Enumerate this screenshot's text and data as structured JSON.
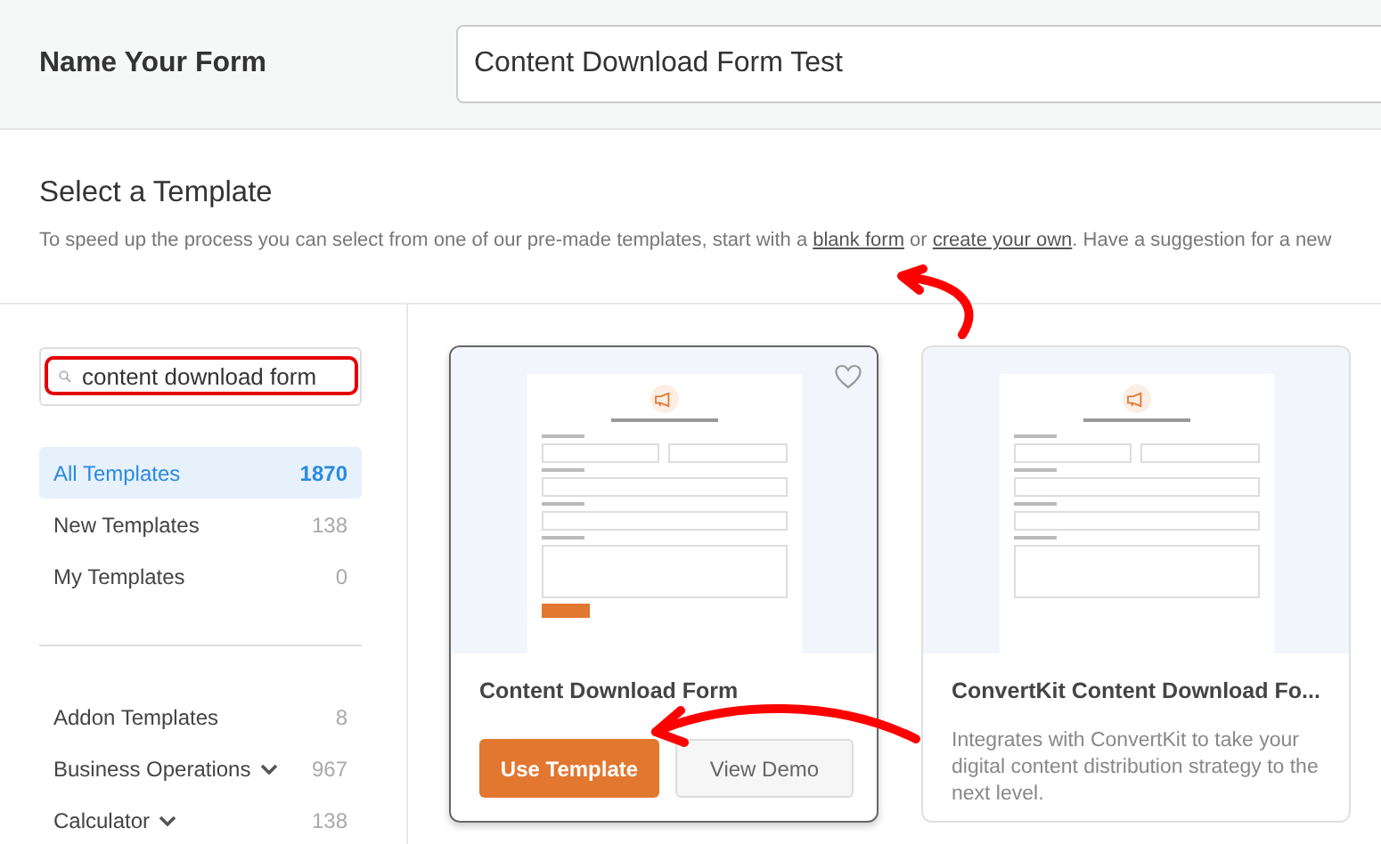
{
  "header": {
    "label": "Name Your Form",
    "form_name": "Content Download Form Test"
  },
  "intro": {
    "title": "Select a Template",
    "text_before": "To speed up the process you can select from one of our pre-made templates, start with a",
    "link_blank": "blank form",
    "text_mid": "or",
    "link_create": "create your own",
    "text_after": ". Have a suggestion for a new"
  },
  "search": {
    "value": "content download form"
  },
  "categories": [
    {
      "label": "All Templates",
      "count": "1870",
      "selected": true,
      "expandable": false
    },
    {
      "label": "New Templates",
      "count": "138",
      "selected": false,
      "expandable": false
    },
    {
      "label": "My Templates",
      "count": "0",
      "selected": false,
      "expandable": false
    }
  ],
  "groups": [
    {
      "label": "Addon Templates",
      "count": "8",
      "selected": false,
      "expandable": false
    },
    {
      "label": "Business Operations",
      "count": "967",
      "selected": false,
      "expandable": true
    },
    {
      "label": "Calculator",
      "count": "138",
      "selected": false,
      "expandable": true
    }
  ],
  "templates": [
    {
      "title": "Content Download Form",
      "hovered": true,
      "favorite_icon": true,
      "buttons": [
        "Use Template",
        "View Demo"
      ]
    },
    {
      "title": "ConvertKit Content Download Fo...",
      "hovered": false,
      "favorite_icon": false,
      "description": "Integrates with ConvertKit to take your digital content distribution strategy to the next level."
    }
  ]
}
